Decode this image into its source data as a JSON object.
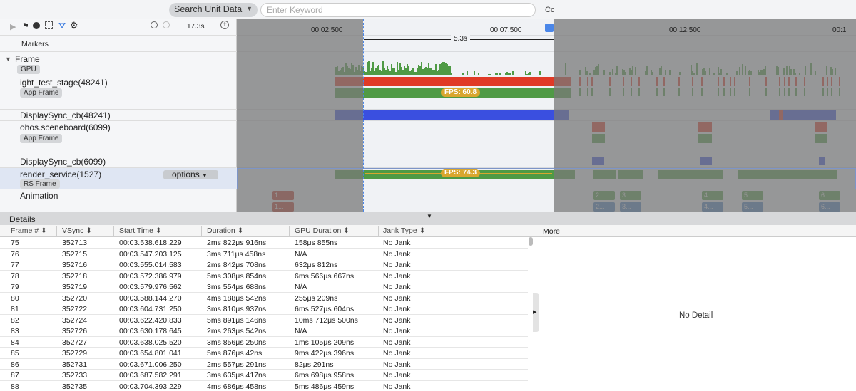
{
  "toolbar": {
    "search_unit": "Search Unit Data",
    "keyword_placeholder": "Enter Keyword",
    "case_label": "Cc",
    "duration": "17.3s"
  },
  "timeline": {
    "ticks": [
      "00:02.500",
      "00:07.500",
      "00:12.500",
      "00:1"
    ],
    "selection_span": "5.3s",
    "markers_label": "Markers",
    "fps_app": "FPS: 60.8",
    "fps_rs": "FPS: 74.3",
    "options_label": "options",
    "animation_labels": [
      "1...",
      "2...",
      "3...",
      "4...",
      "5...",
      "6..."
    ]
  },
  "tracks": [
    {
      "label": "Frame",
      "tag": "GPU"
    },
    {
      "label": "ight_test_stage(48241)",
      "tag": "App Frame"
    },
    {
      "label": "DisplaySync_cb(48241)"
    },
    {
      "label": "ohos.sceneboard(6099)",
      "tag": "App Frame"
    },
    {
      "label": "DisplaySync_cb(6099)"
    },
    {
      "label": "render_service(1527)",
      "tag": "RS Frame"
    },
    {
      "label": "Animation"
    }
  ],
  "colors": {
    "red": "#e03a26",
    "green": "#4f9a45",
    "blue": "#3a4fe0",
    "fps": "#d9a62e",
    "selection": "#4a86e8"
  },
  "details": {
    "title": "Details",
    "more_label": "More",
    "no_detail": "No Detail",
    "columns": [
      "Frame #",
      "VSync",
      "Start Time",
      "Duration",
      "GPU Duration",
      "Jank Type"
    ],
    "rows": [
      [
        "75",
        "352713",
        "00:03.538.618.229",
        "2ms 822μs 916ns",
        "158μs 855ns",
        "No Jank"
      ],
      [
        "76",
        "352715",
        "00:03.547.203.125",
        "3ms 711μs 458ns",
        "N/A",
        "No Jank"
      ],
      [
        "77",
        "352716",
        "00:03.555.014.583",
        "2ms 842μs 708ns",
        "632μs 812ns",
        "No Jank"
      ],
      [
        "78",
        "352718",
        "00:03.572.386.979",
        "5ms 308μs 854ns",
        "6ms 566μs 667ns",
        "No Jank"
      ],
      [
        "79",
        "352719",
        "00:03.579.976.562",
        "3ms 554μs 688ns",
        "N/A",
        "No Jank"
      ],
      [
        "80",
        "352720",
        "00:03.588.144.270",
        "4ms 188μs 542ns",
        "255μs 209ns",
        "No Jank"
      ],
      [
        "81",
        "352722",
        "00:03.604.731.250",
        "3ms 810μs 937ns",
        "6ms 527μs 604ns",
        "No Jank"
      ],
      [
        "82",
        "352724",
        "00:03.622.420.833",
        "5ms 891μs 146ns",
        "10ms 712μs 500ns",
        "No Jank"
      ],
      [
        "83",
        "352726",
        "00:03.630.178.645",
        "2ms 263μs 542ns",
        "N/A",
        "No Jank"
      ],
      [
        "84",
        "352727",
        "00:03.638.025.520",
        "3ms 856μs 250ns",
        "1ms 105μs 209ns",
        "No Jank"
      ],
      [
        "85",
        "352729",
        "00:03.654.801.041",
        "5ms 876μs 42ns",
        "9ms 422μs 396ns",
        "No Jank"
      ],
      [
        "86",
        "352731",
        "00:03.671.006.250",
        "2ms 557μs 291ns",
        "82μs 291ns",
        "No Jank"
      ],
      [
        "87",
        "352733",
        "00:03.687.582.291",
        "3ms 635μs 417ns",
        "6ms 698μs 958ns",
        "No Jank"
      ],
      [
        "88",
        "352735",
        "00:03.704.393.229",
        "4ms 686μs 458ns",
        "5ms 486μs 459ns",
        "No Jank"
      ]
    ]
  }
}
